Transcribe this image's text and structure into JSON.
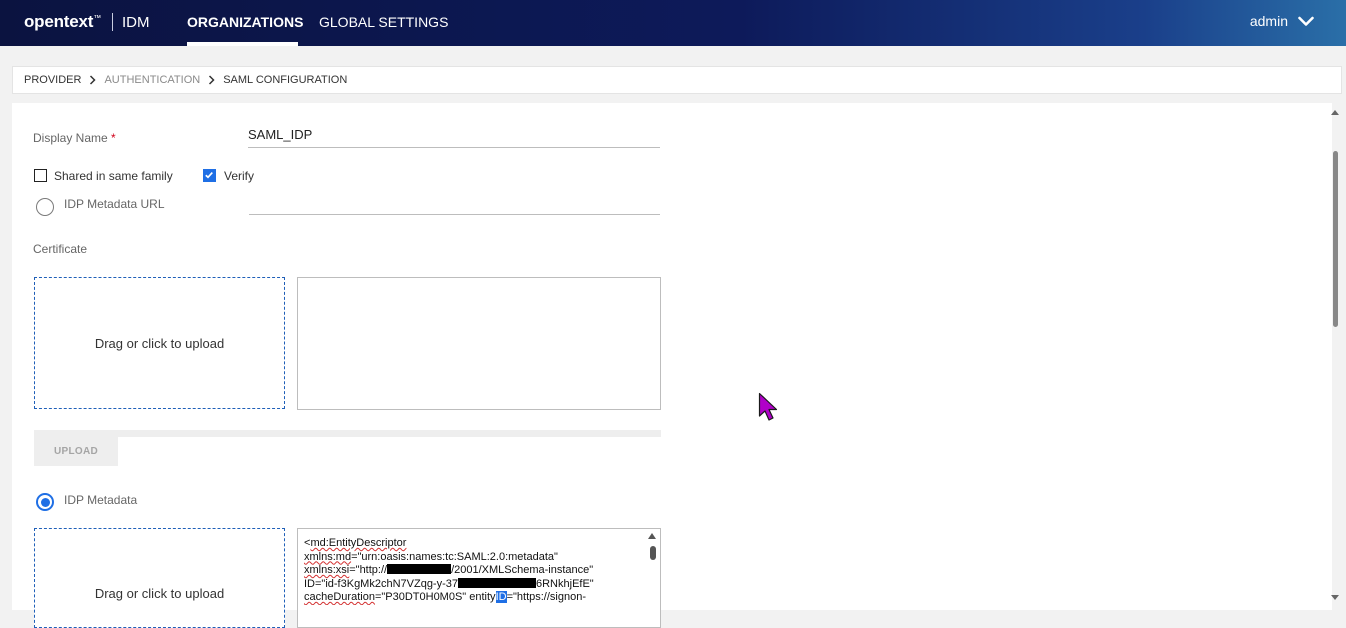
{
  "header": {
    "logo": "opentext",
    "logo_tm": "™",
    "product": "IDM",
    "tabs": [
      {
        "label": "ORGANIZATIONS",
        "active": true
      },
      {
        "label": "GLOBAL SETTINGS",
        "active": false
      }
    ],
    "user": "admin"
  },
  "breadcrumb": [
    "PROVIDER",
    "AUTHENTICATION",
    "SAML CONFIGURATION"
  ],
  "form": {
    "display_name_label": "Display Name",
    "required_mark": "*",
    "display_name_value": "SAML_IDP",
    "shared_label": "Shared in same family",
    "shared_checked": false,
    "verify_label": "Verify",
    "verify_checked": true,
    "idp_metadata_url_label": "IDP Metadata URL",
    "idp_metadata_url_selected": false,
    "certificate_label": "Certificate",
    "dropzone_label": "Drag or click to upload",
    "upload_button": "UPLOAD",
    "idp_metadata_label": "IDP Metadata",
    "idp_metadata_selected": true,
    "xml": {
      "l1_a": "<",
      "l1_b": "md:EntityDescriptor",
      "l2_a": "xmlns:md",
      "l2_b": "=\"urn:oasis:names:tc:SAML:2.0:metadata\"",
      "l3_a": "xmlns:xsi",
      "l3_b": "=\"http://",
      "l3_c": "/2001/XMLSchema-instance\"",
      "l4_a": "ID=\"id-f3KgMk2chN7VZqg-y-37",
      "l4_b": "6RNkhjEfE\"",
      "l5_a": "cacheDuration",
      "l5_b": "=\"P30DT0H0M0S\" entity",
      "l5_c": "ID",
      "l5_d": "=\"https://signon-"
    }
  },
  "colors": {
    "accent": "#1f6fe5",
    "header_start": "#0b1340",
    "header_end": "#2a6fa8",
    "required": "#d0021b",
    "cursor": "#b000c8"
  }
}
